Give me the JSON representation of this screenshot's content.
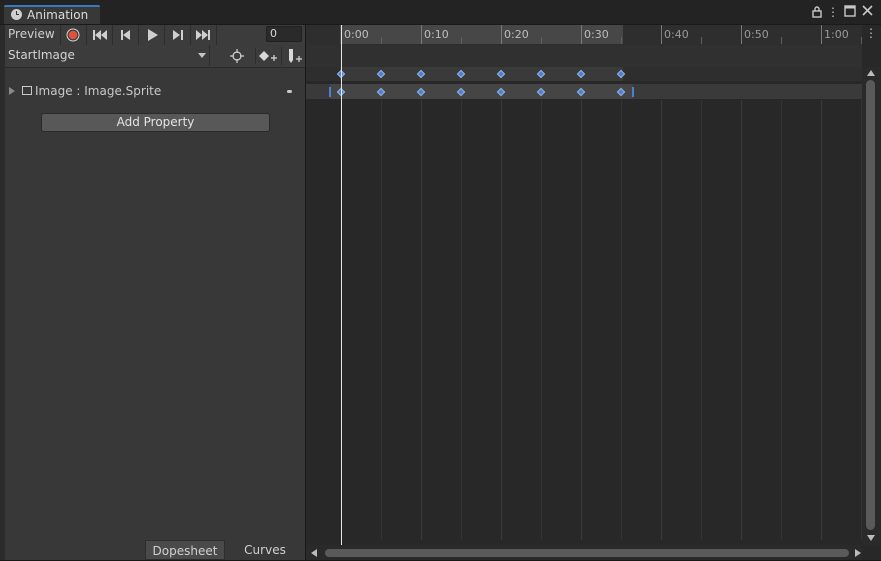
{
  "window": {
    "tab_title": "Animation"
  },
  "toolbar": {
    "preview_label": "Preview",
    "frame_value": "0"
  },
  "clip_selector": {
    "selected": "StartImage"
  },
  "properties": [
    {
      "label": "Image : Image.Sprite"
    }
  ],
  "add_property_label": "Add Property",
  "bottom_tabs": {
    "dopesheet": "Dopesheet",
    "curves": "Curves"
  },
  "ruler_labels": [
    "0:00",
    "0:10",
    "0:20",
    "0:30",
    "0:40",
    "0:50",
    "1:00"
  ],
  "keyframe_frames": [
    0,
    5,
    10,
    15,
    20,
    25,
    30,
    35
  ],
  "colors": {
    "record": "#e0533a",
    "keyframe": "#4c7fd0",
    "tab_accent": "#3a79bb"
  }
}
